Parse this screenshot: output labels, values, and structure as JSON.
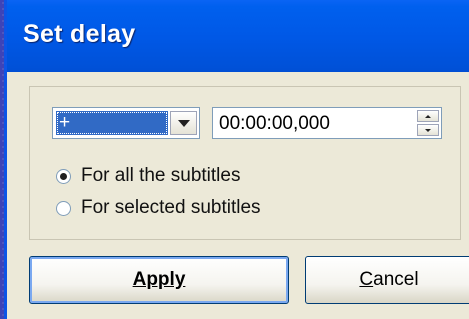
{
  "dialog": {
    "title": "Set delay",
    "sign": {
      "value": "+"
    },
    "time": {
      "value": "00:00:00,000"
    },
    "options": {
      "all_label": "For all the subtitles",
      "selected_label": "For selected subtitles",
      "checked": "all"
    },
    "buttons": {
      "apply_label": "Apply",
      "cancel_label": "Cancel"
    }
  },
  "colors": {
    "titlebar": "#0058e6",
    "window_bg": "#ece9d8",
    "selection": "#316ac5"
  }
}
